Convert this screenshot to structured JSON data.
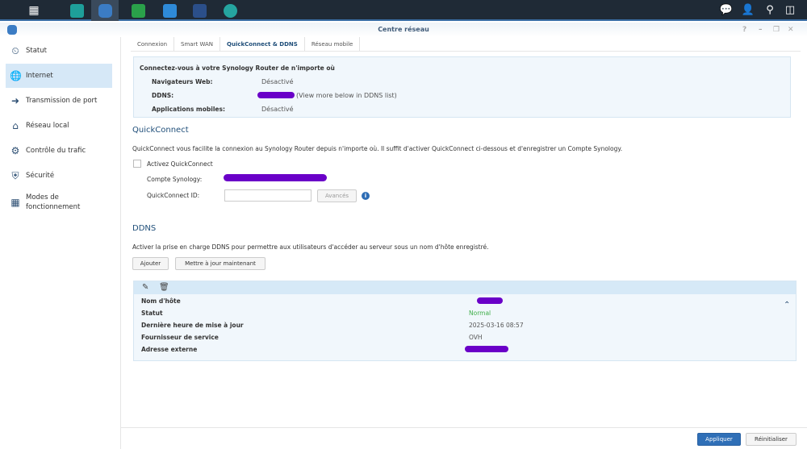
{
  "window": {
    "title": "Centre réseau",
    "controls": [
      "?",
      "–",
      "❐",
      "✕"
    ]
  },
  "taskbar": {
    "apps": [
      "main-menu",
      "network-storage",
      "network-center",
      "wifi",
      "control-panel",
      "dns-server",
      "vpn"
    ],
    "colors": {
      "accent": "#3a6ea5",
      "brand": "#1f4e79"
    }
  },
  "sidebar": {
    "items": [
      {
        "label": "Statut",
        "icon": "⏲"
      },
      {
        "label": "Internet",
        "icon": "🌐"
      },
      {
        "label": "Transmission de port",
        "icon": "➜"
      },
      {
        "label": "Réseau local",
        "icon": "⌂"
      },
      {
        "label": "Contrôle du trafic",
        "icon": "⚙"
      },
      {
        "label": "Sécurité",
        "icon": "⛨"
      },
      {
        "label": "Modes de fonctionnement",
        "icon": "▦"
      }
    ]
  },
  "tabs": [
    "Connexion",
    "Smart WAN",
    "QuickConnect & DDNS",
    "Réseau mobile"
  ],
  "info": {
    "title": "Connectez-vous à votre Synology Router de n'importe où",
    "rows": [
      {
        "label": "Navigateurs Web:",
        "value": "Désactivé"
      },
      {
        "label": "DDNS:",
        "value": "(View more below in DDNS list)"
      },
      {
        "label": "Applications mobiles:",
        "value": "Désactivé"
      }
    ]
  },
  "quickconnect": {
    "heading": "QuickConnect",
    "description": "QuickConnect vous facilite la connexion au Synology Router depuis n'importe où. Il suffit d'activer QuickConnect ci-dessous et d'enregistrer un Compte Synology.",
    "enable_label": "Activez QuickConnect",
    "account_label": "Compte Synology:",
    "id_label": "QuickConnect ID:",
    "id_value": "",
    "advanced_label": "Avancés"
  },
  "ddns": {
    "heading": "DDNS",
    "description": "Activer la prise en charge DDNS pour permettre aux utilisateurs d'accéder au serveur sous un nom d'hôte enregistré.",
    "add_label": "Ajouter",
    "update_label": "Mettre à jour maintenant",
    "rows": [
      {
        "label": "Nom d'hôte",
        "value": ""
      },
      {
        "label": "Statut",
        "value": "Normal"
      },
      {
        "label": "Dernière heure de mise à jour",
        "value": "2025-03-16 08:57"
      },
      {
        "label": "Fournisseur de service",
        "value": "OVH"
      },
      {
        "label": "Adresse externe",
        "value": ""
      }
    ],
    "status_color": "#3fae49"
  },
  "footer": {
    "apply_label": "Appliquer",
    "reset_label": "Réinitialiser"
  }
}
